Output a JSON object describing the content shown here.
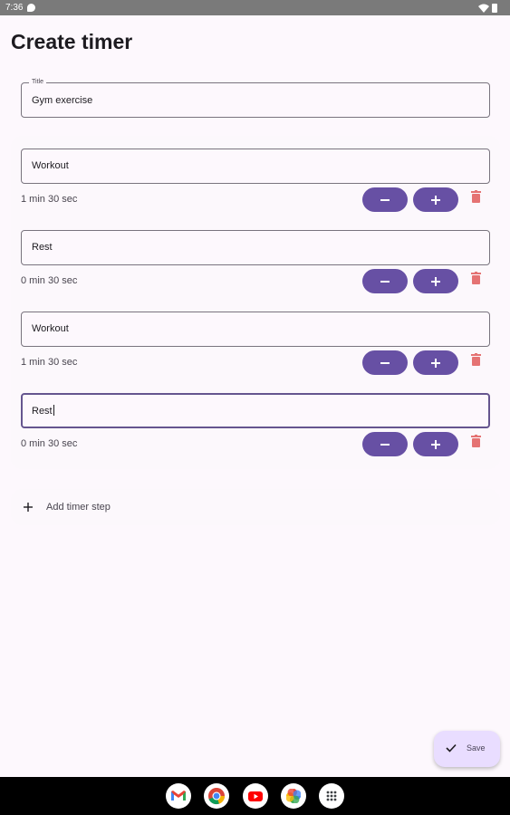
{
  "status_bar": {
    "time": "7:36"
  },
  "page": {
    "title": "Create timer"
  },
  "title_field": {
    "label": "Title",
    "value": "Gym exercise"
  },
  "steps": [
    {
      "name": "Workout",
      "duration": "1 min 30 sec",
      "focused": false
    },
    {
      "name": "Rest",
      "duration": "0 min 30 sec",
      "focused": false
    },
    {
      "name": "Workout",
      "duration": "1 min 30 sec",
      "focused": false
    },
    {
      "name": "Rest",
      "duration": "0 min 30 sec",
      "focused": true
    }
  ],
  "add_step": {
    "label": "Add timer step"
  },
  "save": {
    "label": "Save"
  },
  "dock": [
    "gmail-icon",
    "chrome-icon",
    "youtube-icon",
    "photos-icon",
    "app-drawer-icon"
  ],
  "colors": {
    "primary": "#6750a4",
    "delete": "#e57373",
    "background": "#fdf8fd",
    "fab": "#e9ddff",
    "outline": "#79747e"
  }
}
